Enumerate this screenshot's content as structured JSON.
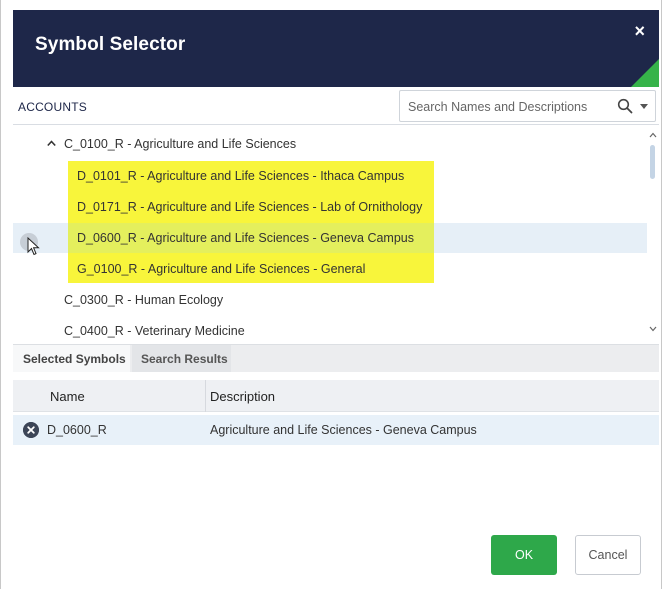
{
  "dialog": {
    "title": "Symbol Selector",
    "close_symbol": "×",
    "accent_color": "#36b349",
    "header_color": "#1e2749"
  },
  "accounts": {
    "label": "ACCOUNTS",
    "search_placeholder": "Search Names and Descriptions"
  },
  "tree": {
    "parent": "C_0100_R - Agriculture and Life Sciences",
    "children": [
      "D_0101_R - Agriculture and Life Sciences - Ithaca Campus",
      "D_0171_R - Agriculture and Life Sciences - Lab of Ornithology",
      "D_0600_R - Agriculture and Life Sciences - Geneva Campus",
      "G_0100_R - Agriculture and Life Sciences - General"
    ],
    "siblings": [
      "C_0300_R - Human Ecology",
      "C_0400_R - Veterinary Medicine"
    ],
    "highlight_color": "#f8f53b"
  },
  "tabs": {
    "selected": "Selected Symbols",
    "search_results": "Search Results"
  },
  "table": {
    "columns": {
      "name": "Name",
      "description": "Description"
    },
    "rows": [
      {
        "name": "D_0600_R",
        "description": "Agriculture and Life Sciences - Geneva Campus"
      }
    ]
  },
  "buttons": {
    "ok": "OK",
    "cancel": "Cancel"
  }
}
